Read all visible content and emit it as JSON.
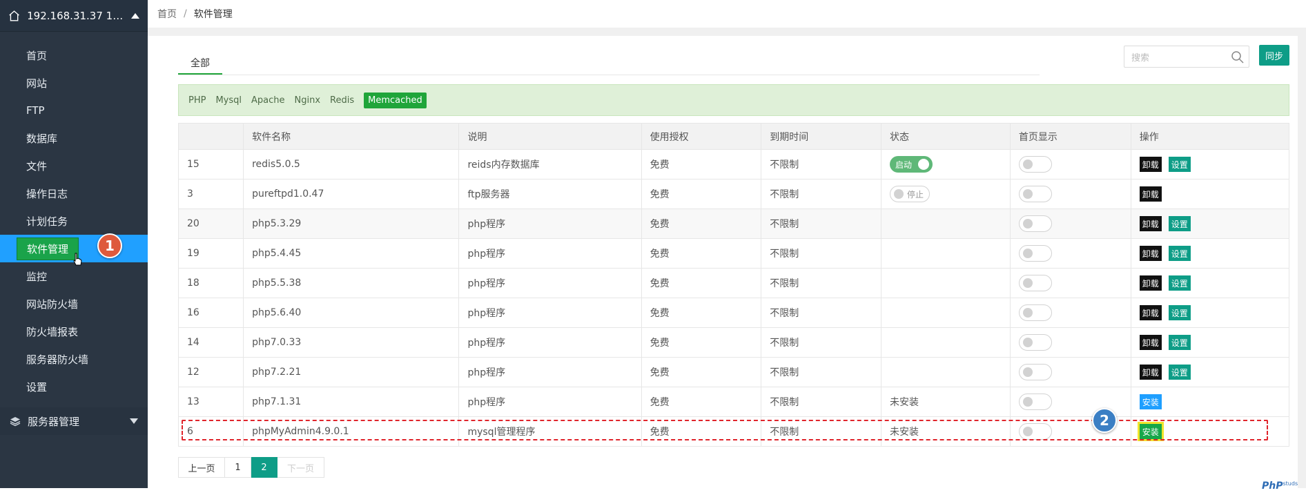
{
  "sidebar": {
    "server_label": "192.168.31.37 192.1...",
    "items": [
      {
        "label": "首页"
      },
      {
        "label": "网站"
      },
      {
        "label": "FTP"
      },
      {
        "label": "数据库"
      },
      {
        "label": "文件"
      },
      {
        "label": "操作日志"
      },
      {
        "label": "计划任务"
      },
      {
        "label": "软件管理"
      },
      {
        "label": "监控"
      },
      {
        "label": "网站防火墙"
      },
      {
        "label": "防火墙报表"
      },
      {
        "label": "服务器防火墙"
      },
      {
        "label": "设置"
      }
    ],
    "active_index": 7,
    "group_label": "服务器管理"
  },
  "breadcrumb": {
    "home": "首页",
    "separator": "/",
    "current": "软件管理"
  },
  "tabs": [
    {
      "label": "全部"
    }
  ],
  "search": {
    "placeholder": "搜索"
  },
  "sync_label": "同步",
  "filters": [
    "PHP",
    "Mysql",
    "Apache",
    "Nginx",
    "Redis",
    "Memcached"
  ],
  "selected_filter": "Memcached",
  "table": {
    "headers": [
      "",
      "软件名称",
      "说明",
      "使用授权",
      "到期时间",
      "状态",
      "首页显示",
      "操作"
    ],
    "rows": [
      {
        "id": "15",
        "name": "redis5.0.5",
        "desc": "reids内存数据库",
        "license": "免费",
        "expire": "不限制",
        "status": "启动"
      },
      {
        "id": "3",
        "name": "pureftpd1.0.47",
        "desc": "ftp服务器",
        "license": "免费",
        "expire": "不限制",
        "status": "停止"
      },
      {
        "id": "20",
        "name": "php5.3.29",
        "desc": "php程序",
        "license": "免费",
        "expire": "不限制",
        "status": ""
      },
      {
        "id": "19",
        "name": "php5.4.45",
        "desc": "php程序",
        "license": "免费",
        "expire": "不限制",
        "status": ""
      },
      {
        "id": "18",
        "name": "php5.5.38",
        "desc": "php程序",
        "license": "免费",
        "expire": "不限制",
        "status": ""
      },
      {
        "id": "16",
        "name": "php5.6.40",
        "desc": "php程序",
        "license": "免费",
        "expire": "不限制",
        "status": ""
      },
      {
        "id": "14",
        "name": "php7.0.33",
        "desc": "php程序",
        "license": "免费",
        "expire": "不限制",
        "status": ""
      },
      {
        "id": "12",
        "name": "php7.2.21",
        "desc": "php程序",
        "license": "免费",
        "expire": "不限制",
        "status": ""
      },
      {
        "id": "13",
        "name": "php7.1.31",
        "desc": "php程序",
        "license": "免费",
        "expire": "不限制",
        "status": "未安装"
      },
      {
        "id": "6",
        "name": "phpMyAdmin4.9.0.1",
        "desc": "mysql管理程序",
        "license": "免费",
        "expire": "不限制",
        "status": "未安装"
      }
    ],
    "actions": {
      "uninstall": "卸载",
      "settings": "设置",
      "install": "安装"
    }
  },
  "pager": {
    "prev": "上一页",
    "pages": [
      "1",
      "2"
    ],
    "current": "2",
    "next": "下一页"
  },
  "annotations": {
    "step1": "1",
    "step2": "2"
  },
  "watermark": {
    "main": "PhP",
    "sub": "studs"
  }
}
